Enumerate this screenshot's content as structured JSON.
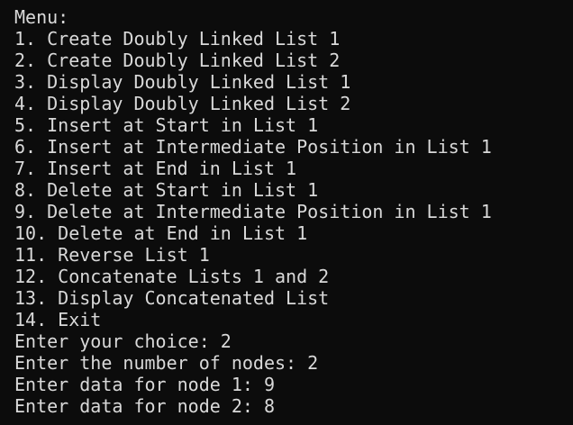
{
  "console": {
    "lines": [
      "Menu:",
      "1. Create Doubly Linked List 1",
      "2. Create Doubly Linked List 2",
      "3. Display Doubly Linked List 1",
      "4. Display Doubly Linked List 2",
      "5. Insert at Start in List 1",
      "6. Insert at Intermediate Position in List 1",
      "7. Insert at End in List 1",
      "8. Delete at Start in List 1",
      "9. Delete at Intermediate Position in List 1",
      "10. Delete at End in List 1",
      "11. Reverse List 1",
      "12. Concatenate Lists 1 and 2",
      "13. Display Concatenated List",
      "14. Exit",
      "Enter your choice: 2",
      "Enter the number of nodes: 2",
      "Enter data for node 1: 9",
      "Enter data for node 2: 8"
    ]
  },
  "colors": {
    "background": "#0c0c0c",
    "text": "#d9d9d9"
  }
}
